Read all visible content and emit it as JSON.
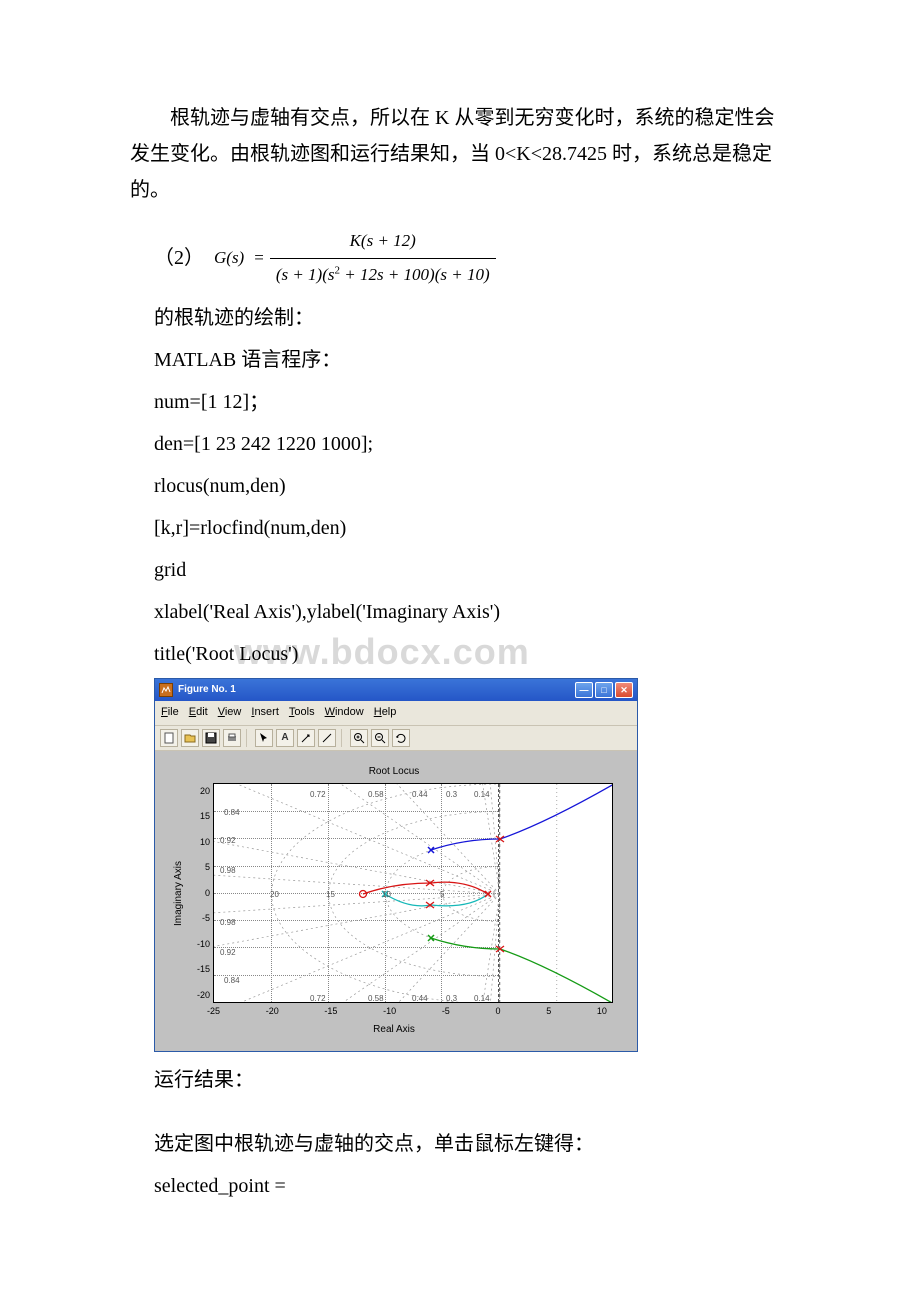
{
  "intro": "　　根轨迹与虚轴有交点，所以在 K 从零到无穷变化时，系统的稳定性会发生变化。由根轨迹图和运行结果知，当 0<K<28.7425 时，系统总是稳定的。",
  "formula": {
    "label": "（2）",
    "lhs": "G(s)",
    "eq": "=",
    "numerator": "K(s + 12)",
    "denominator_left": "(s + 1)(s",
    "denominator_sup": "2",
    "denominator_mid": " + 12s + 100)(s + 10)"
  },
  "lines": {
    "l1": "的根轨迹的绘制：",
    "l2": "MATLAB 语言程序：",
    "c1": "num=[1 12]；",
    "c2": "den=[1 23 242 1220 1000];",
    "c3": "rlocus(num,den)",
    "c4": "[k,r]=rlocfind(num,den)",
    "c5": "grid",
    "c6": "xlabel('Real Axis'),ylabel('Imaginary Axis')",
    "c7": "title('Root Locus')",
    "r1": "运行结果：",
    "r2": "选定图中根轨迹与虚轴的交点，单击鼠标左键得：",
    "r3": "selected_point ="
  },
  "watermark": "www.bdocx.com",
  "figure": {
    "title": "Figure No. 1",
    "menus": [
      "File",
      "Edit",
      "View",
      "Insert",
      "Tools",
      "Window",
      "Help"
    ],
    "plot_title": "Root Locus",
    "ylabel": "Imaginary Axis",
    "xlabel": "Real Axis",
    "yticks": [
      "20",
      "15",
      "10",
      "5",
      "0",
      "-5",
      "-10",
      "-15",
      "-20"
    ],
    "xticks": [
      "-25",
      "-20",
      "-15",
      "-10",
      "-5",
      "0",
      "5",
      "10"
    ],
    "damping": [
      "0.72",
      "0.58",
      "0.44",
      "0.3",
      "0.14",
      "0.84",
      "0.92",
      "0.98"
    ],
    "wn": [
      "20",
      "15",
      "10",
      "5"
    ]
  },
  "chart_data": {
    "type": "line",
    "title": "Root Locus",
    "xlabel": "Real Axis",
    "ylabel": "Imaginary Axis",
    "xlim": [
      -25,
      10
    ],
    "ylim": [
      -20,
      20
    ],
    "open_loop_poles": [
      [
        -1,
        0
      ],
      [
        -10,
        0
      ],
      [
        -6,
        8
      ],
      [
        -6,
        -8
      ]
    ],
    "open_loop_zeros": [
      [
        -12,
        0
      ]
    ],
    "damping_ratio_gridlines": [
      0.14,
      0.3,
      0.44,
      0.58,
      0.72,
      0.84,
      0.92,
      0.98
    ],
    "natural_frequency_gridlines": [
      5,
      10,
      15,
      20
    ],
    "series": [
      {
        "name": "branch-blue",
        "points": [
          [
            -6,
            8
          ],
          [
            -3,
            9
          ],
          [
            0,
            10
          ],
          [
            4,
            14
          ],
          [
            10,
            20
          ]
        ]
      },
      {
        "name": "branch-green",
        "points": [
          [
            -6,
            -8
          ],
          [
            -3,
            -9
          ],
          [
            0,
            -10
          ],
          [
            4,
            -14
          ],
          [
            10,
            -20
          ]
        ]
      },
      {
        "name": "branch-red",
        "points": [
          [
            -1,
            0
          ],
          [
            -3,
            1
          ],
          [
            -6,
            2
          ],
          [
            -9,
            2
          ],
          [
            -12,
            0
          ]
        ]
      },
      {
        "name": "branch-cyan",
        "points": [
          [
            -10,
            0
          ],
          [
            -9,
            -1
          ],
          [
            -6,
            -2
          ],
          [
            -3,
            -1
          ],
          [
            -1,
            0
          ]
        ]
      },
      {
        "name": "imag-axis-crossings",
        "points": [
          [
            0,
            10
          ],
          [
            0,
            -10
          ]
        ]
      }
    ]
  }
}
